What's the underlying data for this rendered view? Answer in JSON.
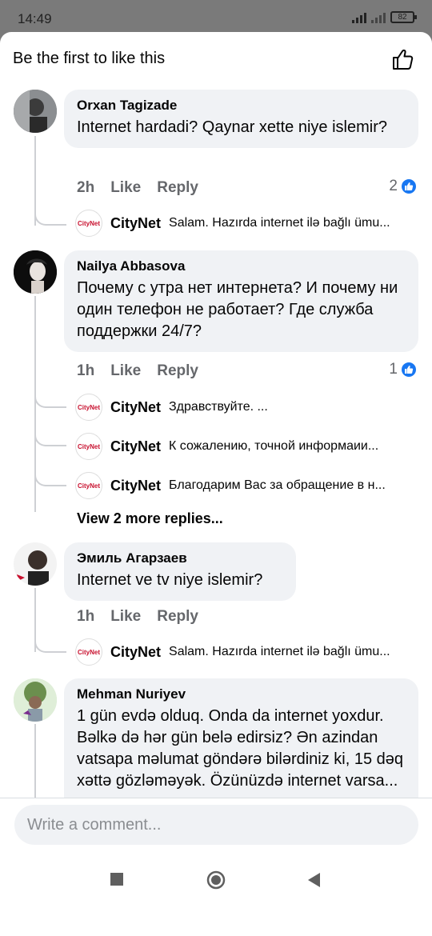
{
  "status": {
    "time": "14:49",
    "battery": "82"
  },
  "header": {
    "likes_text": "Be the first to like this"
  },
  "comments": [
    {
      "name": "Orxan Tagizade",
      "text": "Internet hardadi? Qaynar xette niye islemir?",
      "time": "2h",
      "like": "Like",
      "reply": "Reply",
      "reactions": "2",
      "replies": [
        {
          "avatar": "CityNet",
          "name": "CityNet",
          "text": "Salam. Hazırda internet ilə bağlı ümu..."
        }
      ]
    },
    {
      "name": "Nailya Abbasova",
      "text": "Почему с утра нет интернета? И почему ни один телефон не работает? Где служба поддержки 24/7?",
      "time": "1h",
      "like": "Like",
      "reply": "Reply",
      "reactions": "1",
      "replies": [
        {
          "avatar": "CityNet",
          "name": "CityNet",
          "text": "Здравствуйте. ..."
        },
        {
          "avatar": "CityNet",
          "name": "CityNet",
          "text": "К сожалению, точной информаии..."
        },
        {
          "avatar": "CityNet",
          "name": "CityNet",
          "text": "Благодарим Вас за обращение в н..."
        }
      ],
      "more_replies": "View 2 more replies..."
    },
    {
      "name": "Эмиль Агарзаев",
      "text": "Internet ve tv niye islemir?",
      "time": "1h",
      "like": "Like",
      "reply": "Reply",
      "replies": [
        {
          "avatar": "CityNet",
          "name": "CityNet",
          "text": "Salam. Hazırda internet ilə bağlı ümu..."
        }
      ]
    },
    {
      "name": "Mehman Nuriyev",
      "text": "1 gün evdə olduq. Onda da internet yoxdur. Bəlkə də hər gün belə edirsiz? Ən azindan vatsapa məlumat göndərə bilərdiniz ki, 15 dəq xəttə gözləməyək. Özünüzdə internet varsa..."
    }
  ],
  "composer": {
    "placeholder": "Write a comment..."
  },
  "colors": {
    "accent": "#1877f2",
    "bubble": "#f0f2f5",
    "muted": "#65676b"
  },
  "icons": [
    "like-outline-icon",
    "like-badge-icon",
    "square-nav-icon",
    "home-circle-nav-icon",
    "back-triangle-nav-icon"
  ]
}
